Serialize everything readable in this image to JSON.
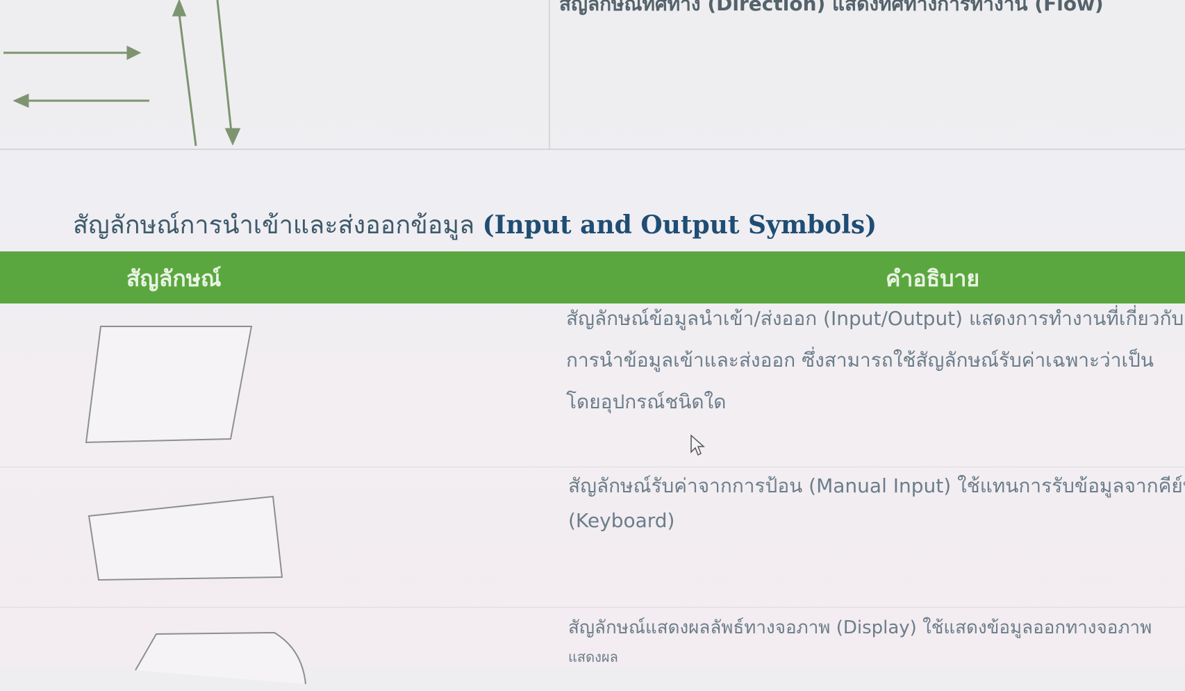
{
  "top_section": {
    "partial_text": "สัญลักษณ์ทิศทาง (Direction) แสดงทิศทางการทำงาน (Flow)"
  },
  "section": {
    "title_th": "สัญลักษณ์การนำเข้าและส่งออกข้อมูล",
    "title_en": "(Input and Output Symbols)"
  },
  "table": {
    "header": {
      "symbol": "สัญลักษณ์",
      "description": "คำอธิบาย"
    },
    "rows": [
      {
        "symbol_icon": "parallelogram-input-output-icon",
        "lines": [
          "สัญลักษณ์ข้อมูลนำเข้า/ส่งออก (Input/Output) แสดงการทำงานที่เกี่ยวกับ",
          "การนำข้อมูลเข้าและส่งออก ซึ่งสามารถใช้สัญลักษณ์รับค่าเฉพาะว่าเป็น",
          "โดยอุปกรณ์ชนิดใด"
        ]
      },
      {
        "symbol_icon": "manual-input-icon",
        "lines": [
          "สัญลักษณ์รับค่าจากการป้อน (Manual Input) ใช้แทนการรับข้อมูลจากคีย์บอร์ด",
          "(Keyboard)"
        ]
      },
      {
        "symbol_icon": "display-icon",
        "lines": [
          "สัญลักษณ์แสดงผลลัพธ์ทางจอภาพ (Display) ใช้แสดงข้อมูลออกทางจอภาพ",
          "แสดงผล"
        ]
      }
    ]
  },
  "colors": {
    "header_green": "#5ba73f",
    "title_blue": "#1f4d73",
    "arrow_green": "#6e8a62"
  }
}
